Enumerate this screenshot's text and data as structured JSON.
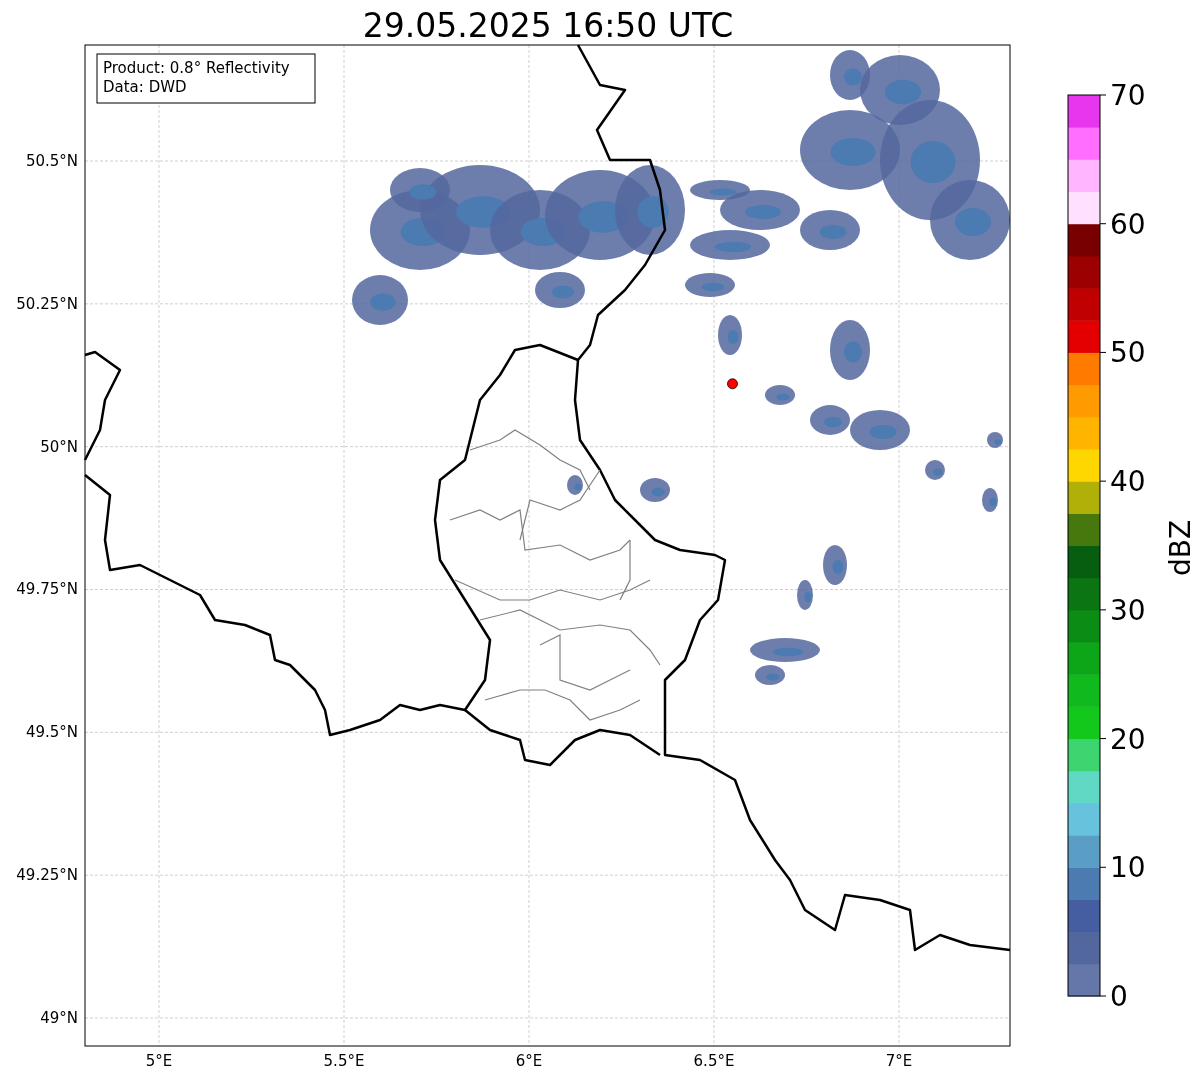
{
  "title": "29.05.2025 16:50 UTC",
  "info_box": [
    "Product: 0.8° Reflectivity",
    "Data: DWD"
  ],
  "y_ticks": [
    "50.5°N",
    "50.25°N",
    "50°N",
    "49.75°N",
    "49.5°N",
    "49.25°N",
    "49°N"
  ],
  "x_ticks": [
    "5°E",
    "5.5°E",
    "6°E",
    "6.5°E",
    "7°E"
  ],
  "colorbar": {
    "label": "dBZ",
    "ticks": [
      "70",
      "60",
      "50",
      "40",
      "30",
      "20",
      "10",
      "0"
    ],
    "colors": [
      {
        "color": "#6577a8"
      },
      {
        "color": "#53679f"
      },
      {
        "color": "#445ea1"
      },
      {
        "color": "#4b7bb0"
      },
      {
        "color": "#5a9ec6"
      },
      {
        "color": "#66c2dd"
      },
      {
        "color": "#5fd8c4"
      },
      {
        "color": "#3dd56f"
      },
      {
        "color": "#12c81a"
      },
      {
        "color": "#10b91c"
      },
      {
        "color": "#0ea619"
      },
      {
        "color": "#0b8c15"
      },
      {
        "color": "#0a7512"
      },
      {
        "color": "#075e10"
      },
      {
        "color": "#47780d"
      },
      {
        "color": "#b0b008"
      },
      {
        "color": "#ffd700"
      },
      {
        "color": "#ffb400"
      },
      {
        "color": "#ff9a00"
      },
      {
        "color": "#ff7b00"
      },
      {
        "color": "#e40000"
      },
      {
        "color": "#c00000"
      },
      {
        "color": "#9c0000"
      },
      {
        "color": "#780000"
      },
      {
        "color": "#ffe1ff"
      },
      {
        "color": "#ffb5ff"
      },
      {
        "color": "#ff6eff"
      },
      {
        "color": "#e835ee"
      }
    ]
  }
}
